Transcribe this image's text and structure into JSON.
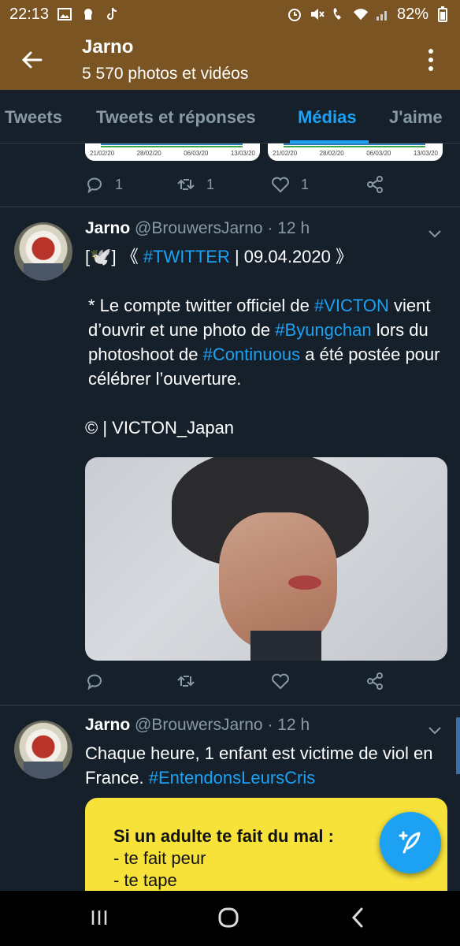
{
  "status_bar": {
    "time": "22:13",
    "battery": "82%",
    "left_icons": [
      "image-icon",
      "android-debug-icon",
      "tiktok-icon"
    ],
    "right_icons": [
      "alarm-icon",
      "mute-icon",
      "wifi-call-icon",
      "wifi-icon",
      "signal-icon",
      "battery-icon"
    ]
  },
  "header": {
    "title": "Jarno",
    "subtitle": "5 570 photos et vidéos",
    "background": "#7a5523"
  },
  "tabs": [
    {
      "label": "Tweets",
      "active": false
    },
    {
      "label": "Tweets et réponses",
      "active": false
    },
    {
      "label": "Médias",
      "active": true
    },
    {
      "label": "J'aime",
      "active": false
    }
  ],
  "prev_tweet": {
    "chart1_ticks": [
      "21/02/20",
      "28/02/20",
      "06/03/20",
      "13/03/20"
    ],
    "chart2_ticks": [
      "21/02/20",
      "28/02/20",
      "06/03/20",
      "13/03/20"
    ],
    "reply_count": "1",
    "retweet_count": "1",
    "like_count": "1"
  },
  "tweets": [
    {
      "name": "Jarno",
      "handle": "@BrouwersJarno",
      "time": "· 12 h",
      "line1_prefix": "[🕊️] 《 ",
      "line1_tag": "#TWITTER",
      "line1_suffix": " | 09.04.2020 》",
      "p1_a": "* Le compte twitter officiel de ",
      "p1_tag1": "#VICTON",
      "p1_b": " vient d’ouvrir et une photo de ",
      "p1_tag2": "#Byungchan",
      "p1_c": " lors du photoshoot de ",
      "p1_tag3": "#Continuous",
      "p1_d": " a été postée pour célébrer l’ouverture.",
      "credit": "© | VICTON_Japan"
    },
    {
      "name": "Jarno",
      "handle": "@BrouwersJarno",
      "time": "· 12 h",
      "text": "Chaque heure, 1 enfant est victime de viol en France. ",
      "tag": "#EntendonsLeursCris",
      "image_lines": [
        "Si un adulte te fait du mal :",
        "- te fait peur",
        "- te tape"
      ]
    }
  ],
  "colors": {
    "background": "#15202b",
    "accent": "#1da1f2",
    "muted": "#8899a6",
    "divider": "#2f3d4d"
  }
}
